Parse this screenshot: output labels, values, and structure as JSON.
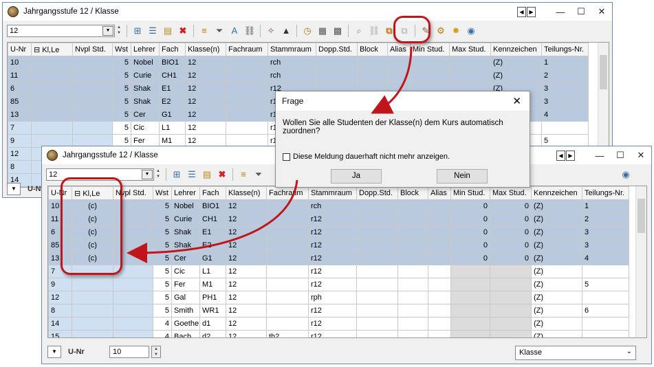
{
  "back_window": {
    "title": "Jahrgangsstufe 12 / Klasse",
    "combo_value": "12",
    "columns": [
      "U-Nr",
      "Kl,Le",
      "Nvpl Std.",
      "Wst",
      "Lehrer",
      "Fach",
      "Klasse(n)",
      "Fachraum",
      "Stammraum",
      "Dopp.Std.",
      "Block",
      "Alias",
      "Min Stud.",
      "Max Stud.",
      "Kennzeichen",
      "Teilungs-Nr."
    ],
    "rows": [
      [
        "10",
        "",
        "",
        "5",
        "Nobel",
        "BIO1",
        "12",
        "",
        "rch",
        "",
        "",
        "",
        "",
        "",
        "(Z)",
        "1"
      ],
      [
        "11",
        "",
        "",
        "5",
        "Curie",
        "CH1",
        "12",
        "",
        "rch",
        "",
        "",
        "",
        "",
        "",
        "(Z)",
        "2"
      ],
      [
        "6",
        "",
        "",
        "5",
        "Shak",
        "E1",
        "12",
        "",
        "r12",
        "",
        "",
        "",
        "",
        "",
        "(Z)",
        "3"
      ],
      [
        "85",
        "",
        "",
        "5",
        "Shak",
        "E2",
        "12",
        "",
        "r12",
        "",
        "",
        "",
        "",
        "",
        "(Z)",
        "3"
      ],
      [
        "13",
        "",
        "",
        "5",
        "Cer",
        "G1",
        "12",
        "",
        "r12",
        "",
        "",
        "",
        "",
        "",
        "(Z)",
        "4"
      ],
      [
        "7",
        "",
        "",
        "5",
        "Cic",
        "L1",
        "12",
        "",
        "r12",
        "",
        "",
        "",
        "",
        "",
        "",
        ""
      ],
      [
        "9",
        "",
        "",
        "5",
        "Fer",
        "M1",
        "12",
        "",
        "r12",
        "",
        "",
        "",
        "",
        "",
        "",
        "5"
      ],
      [
        "12",
        "",
        "",
        "",
        "",
        "",
        "",
        "",
        "",
        "",
        "",
        "",
        "",
        "",
        "",
        ""
      ],
      [
        "8",
        "",
        "",
        "",
        "",
        "",
        "",
        "",
        "",
        "",
        "",
        "",
        "",
        "",
        "",
        ""
      ],
      [
        "14",
        "",
        "",
        "",
        "",
        "",
        "",
        "",
        "",
        "",
        "",
        "",
        "",
        "",
        "",
        ""
      ]
    ],
    "bottom_label": "U-N"
  },
  "dialog": {
    "title": "Frage",
    "message": "Wollen Sie alle Studenten der Klasse(n) dem Kurs automatisch zuordnen?",
    "checkbox_label": "Diese Meldung dauerhaft nicht mehr anzeigen.",
    "yes": "Ja",
    "no": "Nein"
  },
  "front_window": {
    "title": "Jahrgangsstufe 12 / Klasse",
    "combo_value": "12",
    "columns": [
      "U-Nr",
      "Kl,Le",
      "Nvpl Std.",
      "Wst",
      "Lehrer",
      "Fach",
      "Klasse(n)",
      "Fachraum",
      "Stammraum",
      "Dopp.Std.",
      "Block",
      "Alias",
      "Min Stud.",
      "Max Stud.",
      "Kennzeichen",
      "Teilungs-Nr."
    ],
    "rows": [
      [
        "10",
        "(c)",
        "",
        "5",
        "Nobel",
        "BIO1",
        "12",
        "",
        "rch",
        "",
        "",
        "",
        "0",
        "0",
        "(Z)",
        "1"
      ],
      [
        "11",
        "(c)",
        "",
        "5",
        "Curie",
        "CH1",
        "12",
        "",
        "r12",
        "",
        "",
        "",
        "0",
        "0",
        "(Z)",
        "2"
      ],
      [
        "6",
        "(c)",
        "",
        "5",
        "Shak",
        "E1",
        "12",
        "",
        "r12",
        "",
        "",
        "",
        "0",
        "0",
        "(Z)",
        "3"
      ],
      [
        "85",
        "(c)",
        "",
        "5",
        "Shak",
        "E2",
        "12",
        "",
        "r12",
        "",
        "",
        "",
        "0",
        "0",
        "(Z)",
        "3"
      ],
      [
        "13",
        "(c)",
        "",
        "5",
        "Cer",
        "G1",
        "12",
        "",
        "r12",
        "",
        "",
        "",
        "0",
        "0",
        "(Z)",
        "4"
      ],
      [
        "7",
        "",
        "",
        "5",
        "Cic",
        "L1",
        "12",
        "",
        "r12",
        "",
        "",
        "",
        "",
        "",
        "(Z)",
        ""
      ],
      [
        "9",
        "",
        "",
        "5",
        "Fer",
        "M1",
        "12",
        "",
        "r12",
        "",
        "",
        "",
        "",
        "",
        "(Z)",
        "5"
      ],
      [
        "12",
        "",
        "",
        "5",
        "Gal",
        "PH1",
        "12",
        "",
        "rph",
        "",
        "",
        "",
        "",
        "",
        "(Z)",
        ""
      ],
      [
        "8",
        "",
        "",
        "5",
        "Smith",
        "WR1",
        "12",
        "",
        "r12",
        "",
        "",
        "",
        "",
        "",
        "(Z)",
        "6"
      ],
      [
        "14",
        "",
        "",
        "4",
        "Goethe",
        "d1",
        "12",
        "",
        "r12",
        "",
        "",
        "",
        "",
        "",
        "(Z)",
        ""
      ],
      [
        "15",
        "",
        "",
        "4",
        "Bach",
        "d2",
        "12",
        "th2",
        "r12",
        "",
        "",
        "",
        "",
        "",
        "(Z)",
        ""
      ]
    ],
    "bottom_label": "U-Nr",
    "unr_value": "10",
    "select_value": "Klasse"
  },
  "colors": {
    "accent_red": "#c0161b",
    "selected_row": "#b9c9de"
  }
}
